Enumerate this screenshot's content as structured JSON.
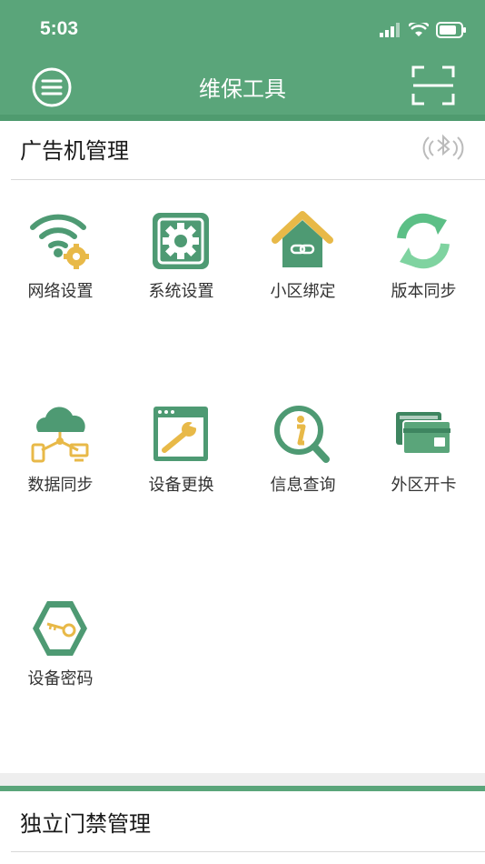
{
  "status_bar": {
    "time": "5:03"
  },
  "header": {
    "title": "维保工具"
  },
  "sections": [
    {
      "title": "广告机管理",
      "items": [
        {
          "label": "网络设置",
          "icon": "wifi-gear-icon"
        },
        {
          "label": "系统设置",
          "icon": "settings-gear-icon"
        },
        {
          "label": "小区绑定",
          "icon": "house-link-icon"
        },
        {
          "label": "版本同步",
          "icon": "sync-arrows-icon"
        },
        {
          "label": "数据同步",
          "icon": "cloud-devices-icon"
        },
        {
          "label": "设备更换",
          "icon": "window-wrench-icon"
        },
        {
          "label": "信息查询",
          "icon": "info-search-icon"
        },
        {
          "label": "外区开卡",
          "icon": "cards-icon"
        },
        {
          "label": "设备密码",
          "icon": "hex-key-icon"
        }
      ]
    },
    {
      "title": "独立门禁管理"
    }
  ],
  "colors": {
    "brand_green": "#5aa57a",
    "icon_green": "#4e9a73",
    "icon_yellow": "#e8b948"
  }
}
